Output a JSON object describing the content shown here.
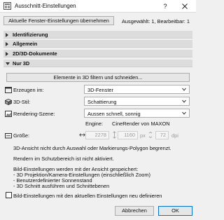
{
  "window": {
    "title": "Ausschnitt-Einstellungen",
    "help_label": "?"
  },
  "top": {
    "apply_button": "Aktuelle Fenster-Einstellungen übernehmen",
    "selection_info": "Ausgewählt: 1, Bearbeitbar: 1"
  },
  "sections": {
    "identifizierung": "Identifizierung",
    "allgemein": "Allgemein",
    "dokumente": "2D/3D-Dokumente",
    "nur3d": "Nur 3D"
  },
  "nur3d": {
    "filter_button": "Elemente in 3D filtern und schneiden...",
    "erzeugen_label": "Erzeugen im:",
    "erzeugen_value": "3D-Fenster",
    "stil_label": "3D-Stil:",
    "stil_value": "Schattierung",
    "rendering_label": "Rendering-Szene:",
    "rendering_value": "Aussen schnell, sonnig",
    "engine_label": "Engine:",
    "engine_value": "CineRender von MAXON",
    "groesse_label": "Größe:",
    "width_value": "2278",
    "height_value": "1160",
    "unit_px": "px",
    "dpi_value": "72",
    "unit_dpi": "dpi",
    "info_marquee": "3D-Ansicht nicht durch Auswahl oder Markierungs-Polygon begrenzt.",
    "info_render": "Rendern im Schutzbereich ist nicht aktiviert.",
    "info_saved_head": "Bild-Einstellungen werden mit der Ansicht gespeichert:",
    "info_saved_1": "- 3D Projektion/Kamera-Einstellungen (einschließlich Zoom)",
    "info_saved_2": "- Benutzerdefinierter Sonnenstand",
    "info_saved_3": "- 3D Schnitt ausführen und Schnittebenen",
    "redefine_checkbox": "Bild-Einstellungen mit den aktuellen Einstellungen neu definieren"
  },
  "footer": {
    "cancel": "Abbrechen",
    "ok": "OK"
  },
  "icons": {
    "app": "view-settings-icon",
    "close": "close-icon",
    "erzeugen": "window-icon",
    "stil": "3d-style-icon",
    "rendering": "rendering-icon",
    "groesse": "size-icon",
    "link": "link-arrows-icon"
  },
  "colors": {
    "ok_border": "#0078d7",
    "section_bg": "#dcdcdc"
  }
}
